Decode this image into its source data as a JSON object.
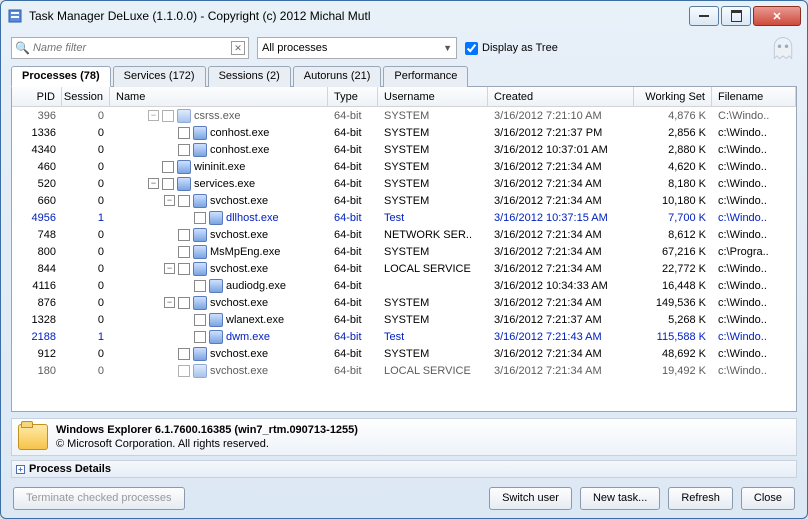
{
  "window": {
    "title": "Task Manager DeLuxe (1.1.0.0) - Copyright (c) 2012 Michal Mutl"
  },
  "toolbar": {
    "filter_placeholder": "Name filter",
    "combo_value": "All processes",
    "tree_checkbox_label": "Display as Tree",
    "tree_checked": true
  },
  "tabs": [
    {
      "label": "Processes (78)",
      "active": true
    },
    {
      "label": "Services (172)",
      "active": false
    },
    {
      "label": "Sessions (2)",
      "active": false
    },
    {
      "label": "Autoruns (21)",
      "active": false
    },
    {
      "label": "Performance",
      "active": false
    }
  ],
  "columns": [
    "PID",
    "Session",
    "Name",
    "Type",
    "Username",
    "Created",
    "Working Set",
    "Filename"
  ],
  "processes": [
    {
      "pid": "396",
      "session": "0",
      "indent": 2,
      "exp": "-",
      "name": "csrss.exe",
      "type": "64-bit",
      "user": "SYSTEM",
      "created": "3/16/2012 7:21:10 AM",
      "ws": "4,876 K",
      "fn": "C:\\Windo..",
      "hl": false,
      "cut": true
    },
    {
      "pid": "1336",
      "session": "0",
      "indent": 3,
      "exp": "",
      "name": "conhost.exe",
      "type": "64-bit",
      "user": "SYSTEM",
      "created": "3/16/2012 7:21:37 PM",
      "ws": "2,856 K",
      "fn": "c:\\Windo..",
      "hl": false
    },
    {
      "pid": "4340",
      "session": "0",
      "indent": 3,
      "exp": "",
      "name": "conhost.exe",
      "type": "64-bit",
      "user": "SYSTEM",
      "created": "3/16/2012 10:37:01 AM",
      "ws": "2,880 K",
      "fn": "c:\\Windo..",
      "hl": false
    },
    {
      "pid": "460",
      "session": "0",
      "indent": 2,
      "exp": "",
      "name": "wininit.exe",
      "type": "64-bit",
      "user": "SYSTEM",
      "created": "3/16/2012 7:21:34 AM",
      "ws": "4,620 K",
      "fn": "c:\\Windo..",
      "hl": false
    },
    {
      "pid": "520",
      "session": "0",
      "indent": 2,
      "exp": "-",
      "name": "services.exe",
      "type": "64-bit",
      "user": "SYSTEM",
      "created": "3/16/2012 7:21:34 AM",
      "ws": "8,180 K",
      "fn": "c:\\Windo..",
      "hl": false
    },
    {
      "pid": "660",
      "session": "0",
      "indent": 3,
      "exp": "-",
      "name": "svchost.exe",
      "type": "64-bit",
      "user": "SYSTEM",
      "created": "3/16/2012 7:21:34 AM",
      "ws": "10,180 K",
      "fn": "c:\\Windo..",
      "hl": false
    },
    {
      "pid": "4956",
      "session": "1",
      "indent": 4,
      "exp": "",
      "name": "dllhost.exe",
      "type": "64-bit",
      "user": "Test",
      "created": "3/16/2012 10:37:15 AM",
      "ws": "7,700 K",
      "fn": "c:\\Windo..",
      "hl": true
    },
    {
      "pid": "748",
      "session": "0",
      "indent": 3,
      "exp": "",
      "name": "svchost.exe",
      "type": "64-bit",
      "user": "NETWORK SER..",
      "created": "3/16/2012 7:21:34 AM",
      "ws": "8,612 K",
      "fn": "c:\\Windo..",
      "hl": false
    },
    {
      "pid": "800",
      "session": "0",
      "indent": 3,
      "exp": "",
      "name": "MsMpEng.exe",
      "type": "64-bit",
      "user": "SYSTEM",
      "created": "3/16/2012 7:21:34 AM",
      "ws": "67,216 K",
      "fn": "c:\\Progra..",
      "hl": false
    },
    {
      "pid": "844",
      "session": "0",
      "indent": 3,
      "exp": "-",
      "name": "svchost.exe",
      "type": "64-bit",
      "user": "LOCAL SERVICE",
      "created": "3/16/2012 7:21:34 AM",
      "ws": "22,772 K",
      "fn": "c:\\Windo..",
      "hl": false
    },
    {
      "pid": "4116",
      "session": "0",
      "indent": 4,
      "exp": "",
      "name": "audiodg.exe",
      "type": "64-bit",
      "user": "",
      "created": "3/16/2012 10:34:33 AM",
      "ws": "16,448 K",
      "fn": "c:\\Windo..",
      "hl": false
    },
    {
      "pid": "876",
      "session": "0",
      "indent": 3,
      "exp": "-",
      "name": "svchost.exe",
      "type": "64-bit",
      "user": "SYSTEM",
      "created": "3/16/2012 7:21:34 AM",
      "ws": "149,536 K",
      "fn": "c:\\Windo..",
      "hl": false
    },
    {
      "pid": "1328",
      "session": "0",
      "indent": 4,
      "exp": "",
      "name": "wlanext.exe",
      "type": "64-bit",
      "user": "SYSTEM",
      "created": "3/16/2012 7:21:37 AM",
      "ws": "5,268 K",
      "fn": "c:\\Windo..",
      "hl": false
    },
    {
      "pid": "2188",
      "session": "1",
      "indent": 4,
      "exp": "",
      "name": "dwm.exe",
      "type": "64-bit",
      "user": "Test",
      "created": "3/16/2012 7:21:43 AM",
      "ws": "115,588 K",
      "fn": "c:\\Windo..",
      "hl": true
    },
    {
      "pid": "912",
      "session": "0",
      "indent": 3,
      "exp": "",
      "name": "svchost.exe",
      "type": "64-bit",
      "user": "SYSTEM",
      "created": "3/16/2012 7:21:34 AM",
      "ws": "48,692 K",
      "fn": "c:\\Windo..",
      "hl": false
    },
    {
      "pid": "180",
      "session": "0",
      "indent": 3,
      "exp": "",
      "name": "svchost.exe",
      "type": "64-bit",
      "user": "LOCAL SERVICE",
      "created": "3/16/2012 7:21:34 AM",
      "ws": "19,492 K",
      "fn": "c:\\Windo..",
      "hl": false,
      "cut": true
    }
  ],
  "infobar": {
    "line1": "Windows Explorer 6.1.7600.16385 (win7_rtm.090713-1255)",
    "line2": "© Microsoft Corporation. All rights reserved."
  },
  "process_details_label": "Process Details",
  "buttons": {
    "terminate": "Terminate checked processes",
    "switch_user": "Switch user",
    "new_task": "New task...",
    "refresh": "Refresh",
    "close": "Close"
  }
}
